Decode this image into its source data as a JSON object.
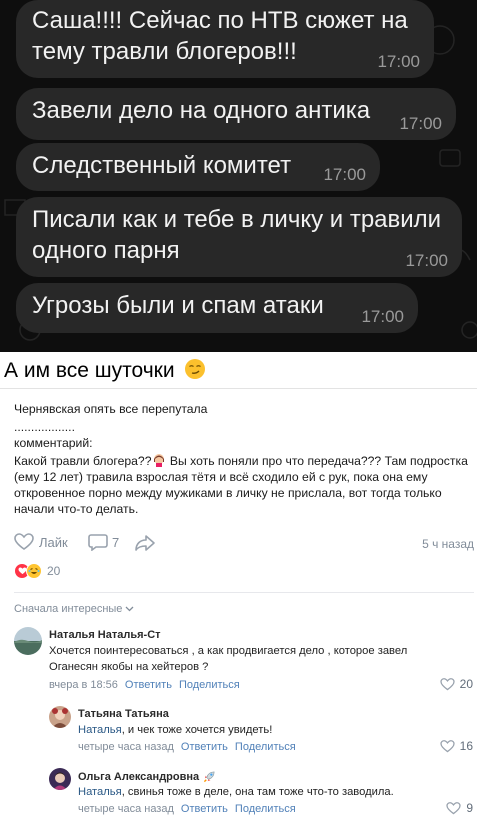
{
  "chat": {
    "messages": [
      {
        "text": "Саша!!!! Сейчас по НТВ сюжет на тему травли блогеров!!!",
        "time": "17:00"
      },
      {
        "text": "Завели дело на одного антика",
        "time": "17:00"
      },
      {
        "text": "Следственный комитет",
        "time": "17:00"
      },
      {
        "text": "Писали как и тебе в личку и травили одного парня",
        "time": "17:00"
      },
      {
        "text": "Угрозы были и спам атаки",
        "time": "17:00"
      }
    ]
  },
  "caption": {
    "text": "А им все шуточки",
    "emoji": "smirk-face-icon"
  },
  "post": {
    "line1": "Чернявская опять все перепутала",
    "line2": "..................",
    "line3": "комментарий:",
    "line4_a": "Какой травли блогера??",
    "line4_b": " Вы хоть поняли про что передача??? Там подростка (ему 12 лет) травила взрослая тётя и всё сходило ей с рук, пока она ему откровенное порно между мужиками в личку не прислала, вот тогда только начали что-то делать.",
    "like_label": "Лайк",
    "comments_count": "7",
    "time": "5 ч назад",
    "reactions_count": "20",
    "sort_label": "Сначала интересные"
  },
  "comments": [
    {
      "author": "Наталья Наталья-Ст",
      "text": "Хочется поинтересоваться , а как продвигается дело , которое завел Оганесян якобы на хейтеров ?",
      "date": "вчера в 18:56",
      "reply": "Ответить",
      "share": "Поделиться",
      "likes": "20"
    },
    {
      "author": "Татьяна Татьяна",
      "mention": "Наталья",
      "text": ", и чек тоже хочется увидеть!",
      "date": "четыре часа назад",
      "reply": "Ответить",
      "share": "Поделиться",
      "likes": "16"
    },
    {
      "author": "Ольга Александровна",
      "mention": "Наталья",
      "text": ", свинья тоже в деле, она там тоже что-то заводила.",
      "date": "четыре часа назад",
      "reply": "Ответить",
      "share": "Поделиться",
      "likes": "9"
    }
  ],
  "colors": {
    "chat_bg": "#0e0e0e",
    "bubble": "#282828",
    "link": "#5181b8",
    "muted": "#818c99",
    "heart": "#ff3347"
  }
}
